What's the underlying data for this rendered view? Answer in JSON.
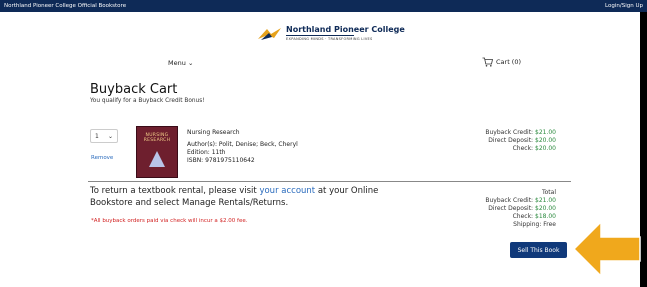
{
  "topbar": {
    "left": "Northland Pioneer College Official Bookstore",
    "right": "Login/Sign Up"
  },
  "logo": {
    "title": "Northland Pioneer College",
    "tagline": "EXPANDING MINDS · TRANSFORMING LIVES"
  },
  "nav": {
    "menu_label": "Menu",
    "cart_label": "Cart (0)"
  },
  "page": {
    "title": "Buyback Cart",
    "subtitle": "You qualify for a Buyback Credit Bonus!"
  },
  "item": {
    "qty": "1",
    "remove_label": "Remove",
    "cover_text": "NURSING RESEARCH",
    "title": "Nursing Research",
    "authors": "Author(s): Polit, Denise; Beck, Cheryl",
    "edition": "Edition: 11th",
    "isbn": "ISBN: 9781975110642",
    "prices": {
      "buyback_label": "Buyback Credit:",
      "buyback_value": "$21.00",
      "direct_label": "Direct Deposit:",
      "direct_value": "$20.00",
      "check_label": "Check:",
      "check_value": "$20.00"
    }
  },
  "rental": {
    "text_before": "To return a textbook rental, please visit ",
    "link": "your account",
    "text_after": " at your Online Bookstore and select Manage Rentals/Returns."
  },
  "warning": "*All buyback orders paid via check will incur a $2.00 fee.",
  "totals": {
    "header": "Total",
    "buyback_label": "Buyback Credit:",
    "buyback_value": "$21.00",
    "direct_label": "Direct Deposit:",
    "direct_value": "$20.00",
    "check_label": "Check:",
    "check_value": "$18.00",
    "shipping_label": "Shipping:",
    "shipping_value": "Free"
  },
  "sell_button": "Sell This Book",
  "colors": {
    "navy": "#0e2a57",
    "button": "#10397a",
    "arrow": "#f0a81c",
    "green": "#2b8a3e",
    "red": "#d11f1f"
  }
}
